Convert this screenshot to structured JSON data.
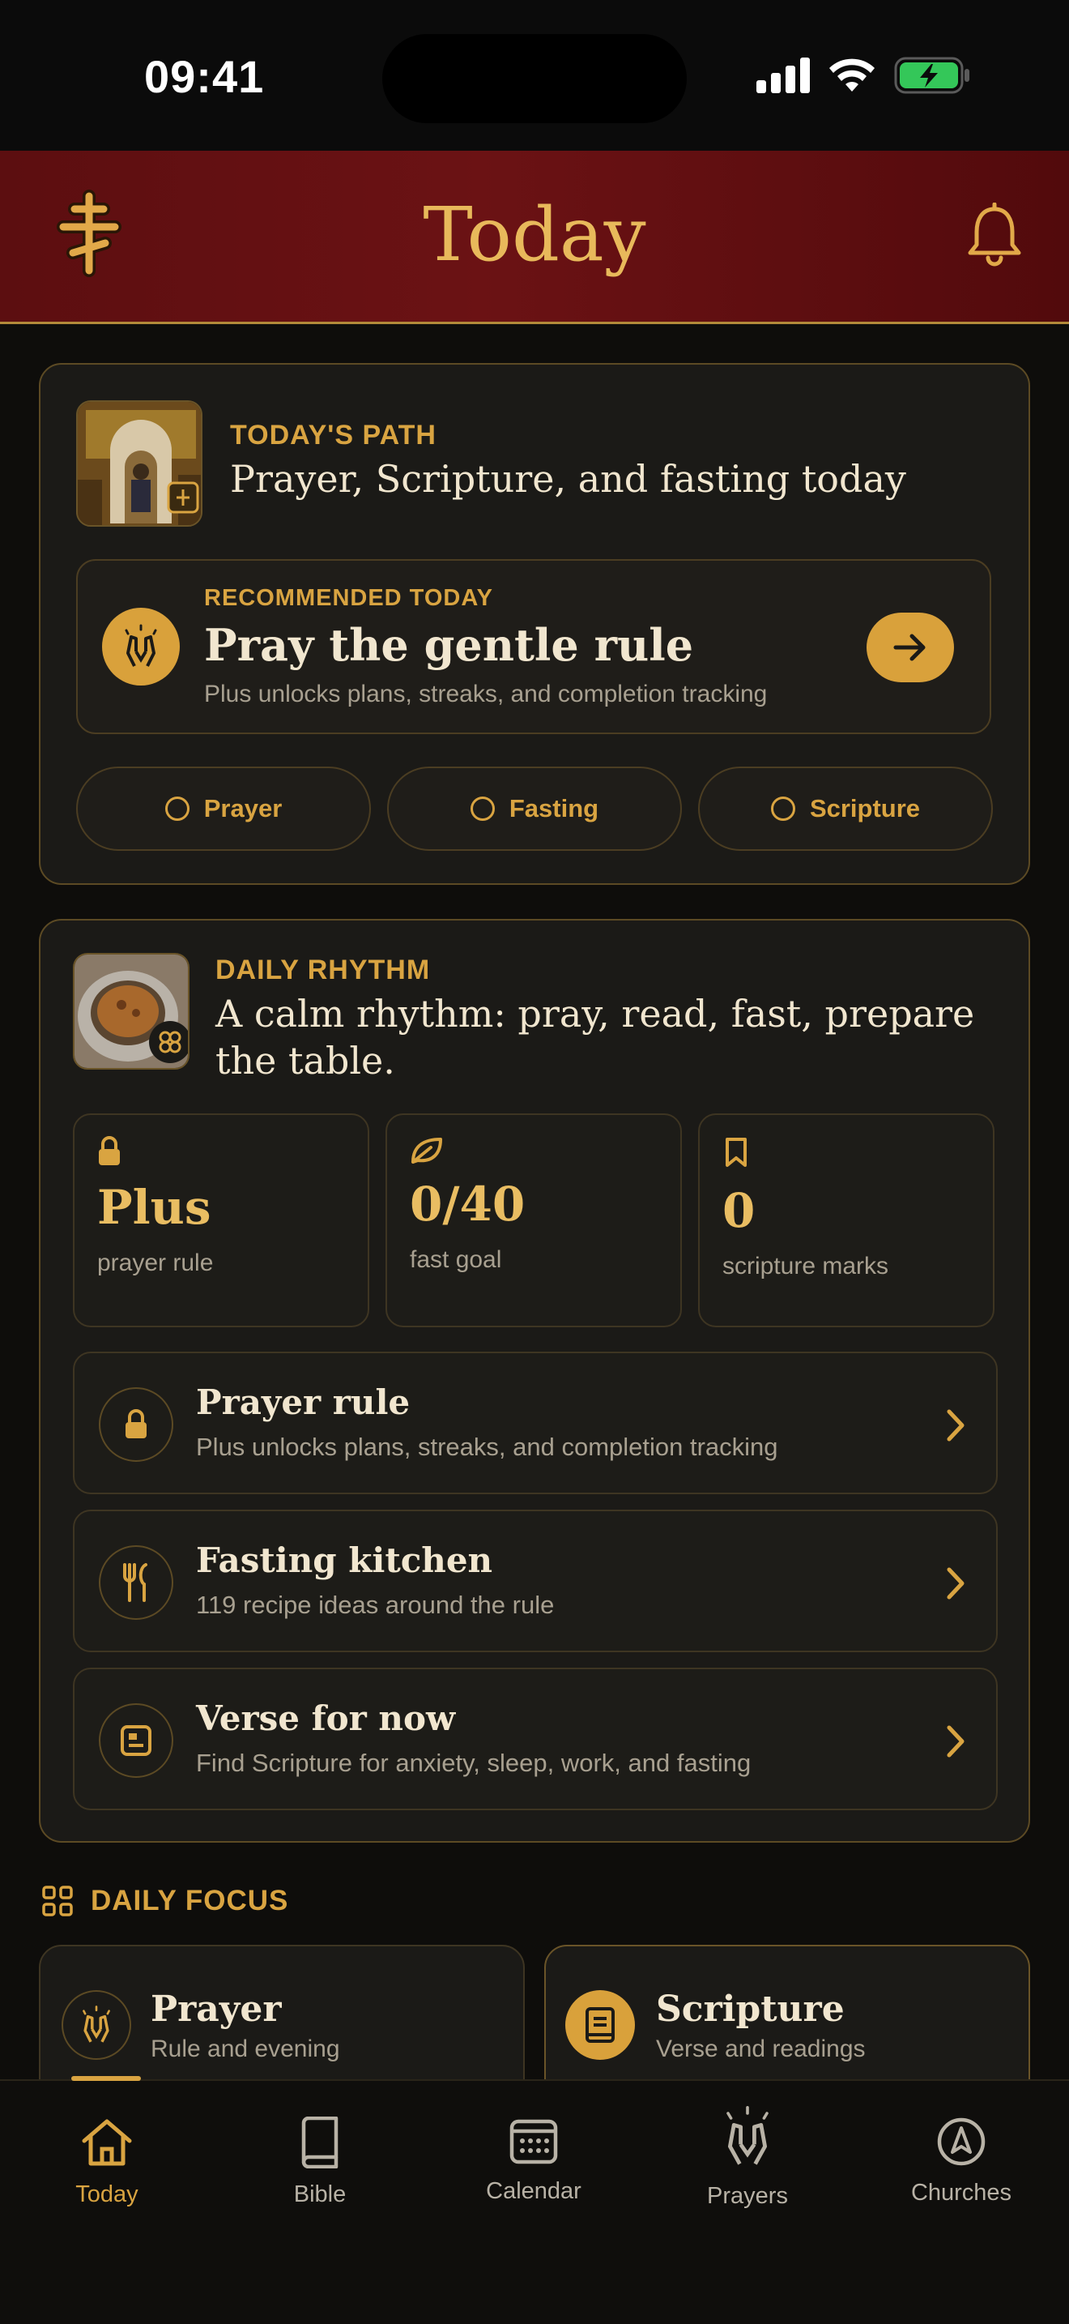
{
  "status_bar": {
    "time": "09:41"
  },
  "header": {
    "title": "Today",
    "menu_icon": "orthodox-cross-icon",
    "notification_icon": "bell-icon"
  },
  "today_path": {
    "eyebrow": "TODAY'S PATH",
    "title": "Prayer, Scripture, and fasting today",
    "recommended": {
      "eyebrow": "RECOMMENDED TODAY",
      "title": "Pray the gentle rule",
      "subtitle": "Plus unlocks plans, streaks, and completion tracking"
    },
    "chips": [
      "Prayer",
      "Fasting",
      "Scripture"
    ]
  },
  "daily_rhythm": {
    "eyebrow": "DAILY RHYTHM",
    "title": "A calm rhythm: pray, read, fast, prepare the table.",
    "stats": [
      {
        "icon": "lock-icon",
        "value": "Plus",
        "label": "prayer rule"
      },
      {
        "icon": "leaf-icon",
        "value": "0/40",
        "label": "fast goal"
      },
      {
        "icon": "bookmark-icon",
        "value": "0",
        "label": "scripture marks"
      }
    ],
    "rows": [
      {
        "icon": "lock-icon",
        "title": "Prayer rule",
        "subtitle": "Plus unlocks plans, streaks, and completion tracking"
      },
      {
        "icon": "fork-knife-icon",
        "title": "Fasting kitchen",
        "subtitle": "119 recipe ideas around the rule"
      },
      {
        "icon": "verse-card-icon",
        "title": "Verse for now",
        "subtitle": "Find Scripture for anxiety, sleep, work, and fasting"
      }
    ]
  },
  "daily_focus": {
    "label": "DAILY FOCUS",
    "cards": [
      {
        "title": "Prayer",
        "subtitle": "Rule and evening"
      },
      {
        "title": "Scripture",
        "subtitle": "Verse and readings"
      }
    ]
  },
  "tabbar": {
    "active": "Today",
    "tabs": [
      {
        "label": "Today",
        "icon": "home-icon"
      },
      {
        "label": "Bible",
        "icon": "book-icon"
      },
      {
        "label": "Calendar",
        "icon": "calendar-icon"
      },
      {
        "label": "Prayers",
        "icon": "praying-hands-icon"
      },
      {
        "label": "Churches",
        "icon": "compass-icon"
      }
    ]
  },
  "colors": {
    "accent": "#d9a441",
    "header_red": "#6b1214",
    "background": "#0e0d0b",
    "card": "#1b1a17"
  }
}
